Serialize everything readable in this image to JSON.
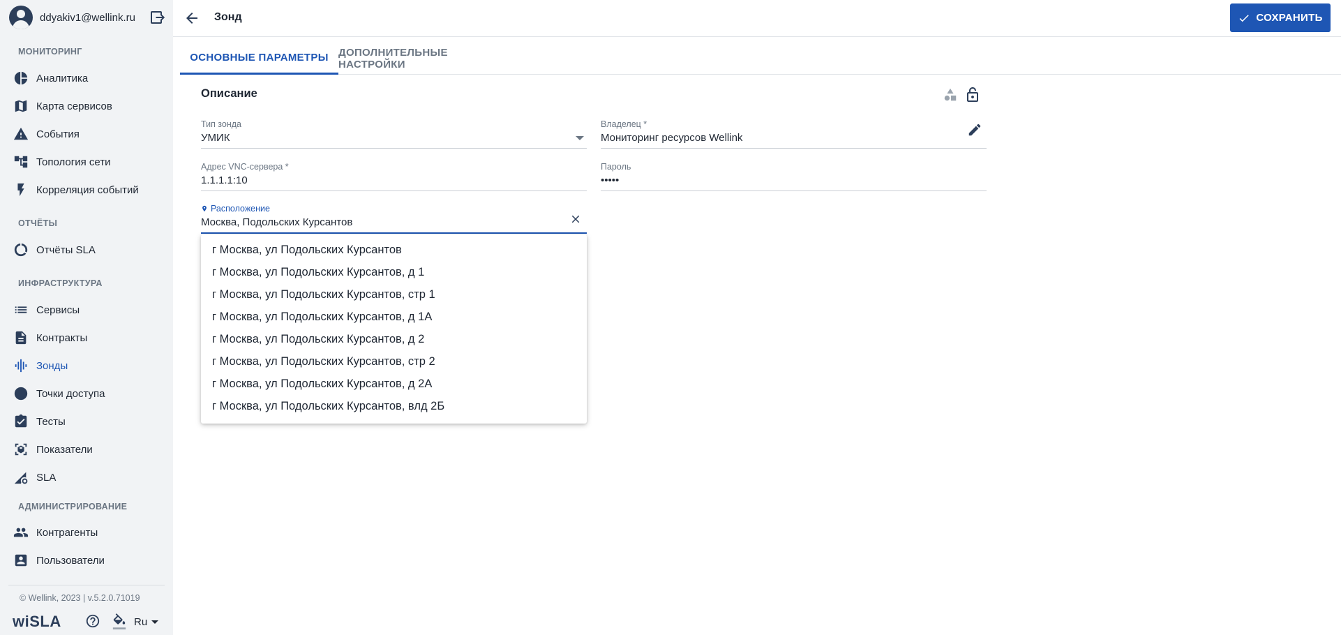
{
  "sidebar": {
    "user_email": "ddyakiv1@wellink.ru",
    "sections": {
      "monitoring": "МОНИТОРИНГ",
      "reports": "ОТЧЁТЫ",
      "infrastructure": "ИНФРАСТРУКТУРА",
      "administration": "АДМИНИСТРИРОВАНИЕ"
    },
    "items": {
      "analytics": "Аналитика",
      "service_map": "Карта сервисов",
      "events": "События",
      "topology": "Топология сети",
      "correlation": "Корреляция событий",
      "sla_reports": "Отчёты SLA",
      "services": "Сервисы",
      "contracts": "Контракты",
      "probes": "Зонды",
      "access_points": "Точки доступа",
      "tests": "Тесты",
      "indicators": "Показатели",
      "sla": "SLA",
      "contractors": "Контрагенты",
      "users": "Пользователи"
    },
    "active_item": "probes",
    "copyright": "© Wellink, 2023 | v.5.2.0.71019",
    "brand": "wiSLA",
    "language": "Ru"
  },
  "header": {
    "title": "Зонд",
    "save_label": "СОХРАНИТЬ"
  },
  "tabs": {
    "main": "ОСНОВНЫЕ ПАРАМЕТРЫ",
    "additional": "ДОПОЛНИТЕЛЬНЫЕ НАСТРОЙКИ"
  },
  "form": {
    "section_title": "Описание",
    "probe_type": {
      "label": "Тип зонда",
      "value": "УМИК"
    },
    "owner": {
      "label": "Владелец *",
      "value": "Мониторинг ресурсов Wellink"
    },
    "vnc_address": {
      "label": "Адрес VNC-сервера *",
      "value": "1.1.1.1:10"
    },
    "password": {
      "label": "Пароль",
      "value": "•••••"
    },
    "location": {
      "label": "Расположение",
      "value": "Москва, Подольских Курсантов"
    }
  },
  "location_suggestions": [
    "г Москва, ул Подольских Курсантов",
    "г Москва, ул Подольских Курсантов, д 1",
    "г Москва, ул Подольских Курсантов, стр 1",
    "г Москва, ул Подольских Курсантов, д 1А",
    "г Москва, ул Подольских Курсантов, д 2",
    "г Москва, ул Подольских Курсантов, стр 2",
    "г Москва, ул Подольских Курсантов, д 2А",
    "г Москва, ул Подольских Курсантов, влд 2Б"
  ],
  "colors": {
    "accent": "#1e56b4",
    "sidebar_bg": "#f1f3f5",
    "text": "#1f2733",
    "muted": "#6b7683"
  }
}
